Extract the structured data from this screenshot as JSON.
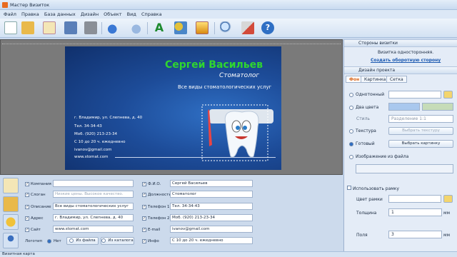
{
  "window": {
    "title": "Мастер Визиток"
  },
  "menu": [
    "Файл",
    "Правка",
    "База данных",
    "Дизайн",
    "Объект",
    "Вид",
    "Справка"
  ],
  "card": {
    "name": "Сергей Васильев",
    "profession": "Стоматолог",
    "services": "Все виды стоматологических услуг",
    "contacts": [
      "г. Владимир, ул. Слепнева, д. 40",
      "Тел. 34-34-43",
      "Моб. (920) 213-23-34",
      "С 10 до 20 ч. ежедневно",
      "ivanov@gmail.com",
      "www.stomat.com"
    ]
  },
  "fields_left": [
    {
      "label": "Компания",
      "value": "",
      "checked": true,
      "dim": false
    },
    {
      "label": "Слоган",
      "value": "Низкие цены. Высокое качество.",
      "checked": true,
      "dim": true
    },
    {
      "label": "Описание",
      "value": "Все виды стоматологических услуг",
      "checked": true,
      "dim": false
    },
    {
      "label": "Адрес",
      "value": "г. Владимир, ул. Слепнева, д. 40",
      "checked": true,
      "dim": false
    },
    {
      "label": "Сайт",
      "value": "www.stomat.com",
      "checked": true,
      "dim": false
    }
  ],
  "fields_right": [
    {
      "label": "Ф.И.О.",
      "value": "Сергей Васильев",
      "checked": true
    },
    {
      "label": "Должность",
      "value": "Стоматолог",
      "checked": true
    },
    {
      "label": "Телефон 1",
      "value": "Тел. 34-34-43",
      "checked": true
    },
    {
      "label": "Телефон 2",
      "value": "Моб. (920) 213-23-34",
      "checked": true
    },
    {
      "label": "E-mail",
      "value": "ivanov@gmail.com",
      "checked": true
    },
    {
      "label": "Инфо",
      "value": "С 10 до 20 ч. ежедневно",
      "checked": true
    }
  ],
  "logo": {
    "label": "Логотип",
    "none": "Нет",
    "from_file": "Из файла",
    "from_catalog": "Из каталога"
  },
  "status": "Визитная карта",
  "panel": {
    "sides_header": "Стороны визитки",
    "sides_text": "Визитка односторонняя.",
    "sides_link": "Создать оборотную сторону",
    "design_header": "Дизайн проекта",
    "tabs": [
      "Фон",
      "Картинка",
      "Сетка"
    ],
    "solid": "Однотонный",
    "two_colors": "Два цвета",
    "style_label": "Стиль",
    "style_value": "Разделение 1:1",
    "texture": "Текстура",
    "choose_texture": "Выбрать текстуру",
    "ready": "Готовый",
    "choose_picture": "Выбрать картинку",
    "from_file_image": "Изображение из файла",
    "use_frame": "Использовать рамку",
    "frame_color": "Цвет рамки",
    "thickness_label": "Толщина",
    "thickness_value": "1",
    "unit_mm": "мм",
    "margins_label": "Поля",
    "margins_value": "3",
    "color1": "#a9c8ee",
    "color2": "#c6dcb8"
  }
}
